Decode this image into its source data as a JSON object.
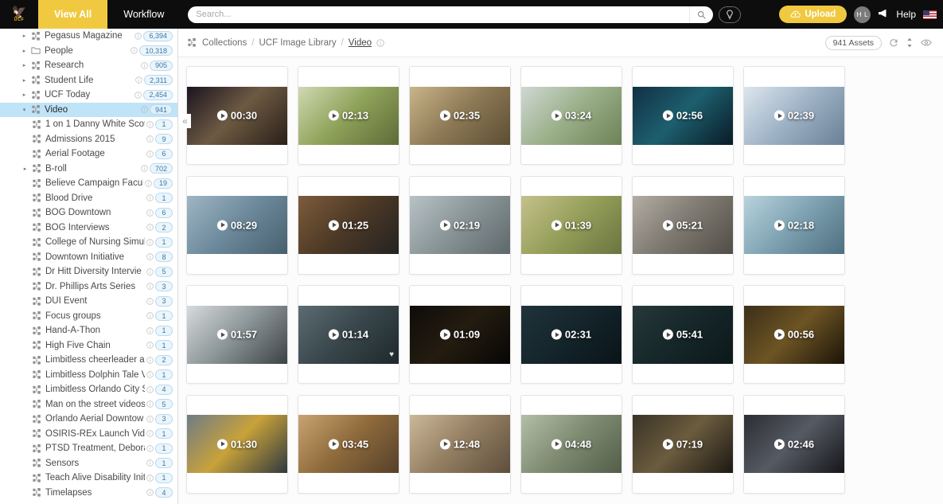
{
  "app": {
    "logo_mark": "🦅",
    "logo_text": "UCF"
  },
  "topbar": {
    "tabs": [
      {
        "label": "View All",
        "active": true
      },
      {
        "label": "Workflow",
        "active": false
      }
    ],
    "search": {
      "placeholder": "Search...",
      "value": "",
      "icon": "search-icon"
    },
    "pin_icon": "pin-icon",
    "upload": {
      "label": "Upload",
      "icon": "cloud-upload-icon"
    },
    "avatar": "H L",
    "megaphone_icon": "megaphone-icon",
    "help_label": "Help",
    "flag_icon": "us-flag-icon"
  },
  "sidebar": {
    "collapse_icon": "«",
    "items": [
      {
        "label": "Pegasus Magazine",
        "count": "6,394",
        "level": 1,
        "caret": "▸",
        "icon": "collection-icon",
        "selected": false
      },
      {
        "label": "People",
        "count": "10,318",
        "level": 1,
        "caret": "▸",
        "icon": "folder-icon",
        "selected": false
      },
      {
        "label": "Research",
        "count": "905",
        "level": 1,
        "caret": "▸",
        "icon": "collection-icon",
        "selected": false
      },
      {
        "label": "Student Life",
        "count": "2,311",
        "level": 1,
        "caret": "▸",
        "icon": "collection-icon",
        "selected": false
      },
      {
        "label": "UCF Today",
        "count": "2,454",
        "level": 1,
        "caret": "▸",
        "icon": "collection-icon",
        "selected": false
      },
      {
        "label": "Video",
        "count": "941",
        "level": 1,
        "caret": "▾",
        "icon": "collection-icon",
        "selected": true
      },
      {
        "label": "1 on 1 Danny White Scot",
        "count": "1",
        "level": 2,
        "caret": "",
        "icon": "collection-icon",
        "selected": false
      },
      {
        "label": "Admissions 2015",
        "count": "9",
        "level": 2,
        "caret": "",
        "icon": "collection-icon",
        "selected": false
      },
      {
        "label": "Aerial Footage",
        "count": "6",
        "level": 2,
        "caret": "",
        "icon": "collection-icon",
        "selected": false
      },
      {
        "label": "B-roll",
        "count": "702",
        "level": 2,
        "caret": "▸",
        "icon": "collection-icon",
        "selected": false
      },
      {
        "label": "Believe Campaign Facul",
        "count": "19",
        "level": 2,
        "caret": "",
        "icon": "collection-icon",
        "selected": false
      },
      {
        "label": "Blood Drive",
        "count": "1",
        "level": 2,
        "caret": "",
        "icon": "collection-icon",
        "selected": false
      },
      {
        "label": "BOG Downtown",
        "count": "6",
        "level": 2,
        "caret": "",
        "icon": "collection-icon",
        "selected": false
      },
      {
        "label": "BOG Interviews",
        "count": "2",
        "level": 2,
        "caret": "",
        "icon": "collection-icon",
        "selected": false
      },
      {
        "label": "College of Nursing Simul",
        "count": "1",
        "level": 2,
        "caret": "",
        "icon": "collection-icon",
        "selected": false
      },
      {
        "label": "Downtown Initiative",
        "count": "8",
        "level": 2,
        "caret": "",
        "icon": "collection-icon",
        "selected": false
      },
      {
        "label": "Dr Hitt Diversity Intervie",
        "count": "5",
        "level": 2,
        "caret": "",
        "icon": "collection-icon",
        "selected": false
      },
      {
        "label": "Dr. Phillips Arts Series",
        "count": "3",
        "level": 2,
        "caret": "",
        "icon": "collection-icon",
        "selected": false
      },
      {
        "label": "DUI Event",
        "count": "3",
        "level": 2,
        "caret": "",
        "icon": "collection-icon",
        "selected": false
      },
      {
        "label": "Focus groups",
        "count": "1",
        "level": 2,
        "caret": "",
        "icon": "collection-icon",
        "selected": false
      },
      {
        "label": "Hand-A-Thon",
        "count": "1",
        "level": 2,
        "caret": "",
        "icon": "collection-icon",
        "selected": false
      },
      {
        "label": "High Five Chain",
        "count": "1",
        "level": 2,
        "caret": "",
        "icon": "collection-icon",
        "selected": false
      },
      {
        "label": "Limbitless cheerleader ar",
        "count": "2",
        "level": 2,
        "caret": "",
        "icon": "collection-icon",
        "selected": false
      },
      {
        "label": "Limbitless Dolphin Tale V",
        "count": "1",
        "level": 2,
        "caret": "",
        "icon": "collection-icon",
        "selected": false
      },
      {
        "label": "Limbitless Orlando City S",
        "count": "4",
        "level": 2,
        "caret": "",
        "icon": "collection-icon",
        "selected": false
      },
      {
        "label": "Man on the street videos",
        "count": "5",
        "level": 2,
        "caret": "",
        "icon": "collection-icon",
        "selected": false
      },
      {
        "label": "Orlando Aerial Downtow",
        "count": "3",
        "level": 2,
        "caret": "",
        "icon": "collection-icon",
        "selected": false
      },
      {
        "label": "OSIRIS-REx Launch Vide",
        "count": "1",
        "level": 2,
        "caret": "",
        "icon": "collection-icon",
        "selected": false
      },
      {
        "label": "PTSD Treatment, Debora",
        "count": "1",
        "level": 2,
        "caret": "",
        "icon": "collection-icon",
        "selected": false
      },
      {
        "label": "Sensors",
        "count": "1",
        "level": 2,
        "caret": "",
        "icon": "collection-icon",
        "selected": false
      },
      {
        "label": "Teach Alive Disability Init",
        "count": "1",
        "level": 2,
        "caret": "",
        "icon": "collection-icon",
        "selected": false
      },
      {
        "label": "Timelapses",
        "count": "4",
        "level": 2,
        "caret": "",
        "icon": "collection-icon",
        "selected": false
      }
    ]
  },
  "main": {
    "breadcrumb": [
      {
        "label": "Collections",
        "current": false
      },
      {
        "label": "UCF Image Library",
        "current": false
      },
      {
        "label": "Video",
        "current": true
      }
    ],
    "separator": "/",
    "asset_count_label": "941 Assets",
    "tools": [
      {
        "name": "refresh-icon",
        "glyph": "⟳"
      },
      {
        "name": "sort-icon",
        "glyph": "⇅"
      },
      {
        "name": "visibility-icon",
        "glyph": "◎"
      }
    ],
    "assets": [
      {
        "duration": "00:30",
        "favorite": false,
        "c1": "#1b1420",
        "c2": "#6d5a43",
        "c3": "#2a1f18"
      },
      {
        "duration": "02:13",
        "favorite": false,
        "c1": "#cfd9b2",
        "c2": "#8fa35a",
        "c3": "#5e6b37"
      },
      {
        "duration": "02:35",
        "favorite": false,
        "c1": "#c9b48a",
        "c2": "#8e7a56",
        "c3": "#5c4d33"
      },
      {
        "duration": "03:24",
        "favorite": false,
        "c1": "#cfd8d4",
        "c2": "#9bb08a",
        "c3": "#6d8257"
      },
      {
        "duration": "02:56",
        "favorite": false,
        "c1": "#123044",
        "c2": "#1d5f6e",
        "c3": "#0a1a26"
      },
      {
        "duration": "02:39",
        "favorite": false,
        "c1": "#dde6ee",
        "c2": "#9fb3c6",
        "c3": "#6a8096"
      },
      {
        "duration": "08:29",
        "favorite": false,
        "c1": "#9fb6c4",
        "c2": "#6d8a9c",
        "c3": "#47606e"
      },
      {
        "duration": "01:25",
        "favorite": false,
        "c1": "#7d5c3c",
        "c2": "#4e3a26",
        "c3": "#30221616"
      },
      {
        "duration": "02:19",
        "favorite": false,
        "c1": "#b9c3c7",
        "c2": "#8a9598",
        "c3": "#5e686b"
      },
      {
        "duration": "01:39",
        "favorite": false,
        "c1": "#c5c08d",
        "c2": "#96a05a",
        "c3": "#6a7440"
      },
      {
        "duration": "05:21",
        "favorite": false,
        "c1": "#b3ada4",
        "c2": "#7f7a71",
        "c3": "#514d47"
      },
      {
        "duration": "02:18",
        "favorite": false,
        "c1": "#b9d3dd",
        "c2": "#7fa3b3",
        "c3": "#4e6f80"
      },
      {
        "duration": "01:57",
        "favorite": false,
        "c1": "#d7dbdd",
        "c2": "#8d9698",
        "c3": "#3b4245"
      },
      {
        "duration": "01:14",
        "favorite": true,
        "c1": "#5c6c72",
        "c2": "#39474c",
        "c3": "#1e282b"
      },
      {
        "duration": "01:09",
        "favorite": false,
        "c1": "#0e0c0a",
        "c2": "#241c10",
        "c3": "#070605"
      },
      {
        "duration": "02:31",
        "favorite": false,
        "c1": "#20333a",
        "c2": "#14252b",
        "c3": "#0a1418"
      },
      {
        "duration": "05:41",
        "favorite": false,
        "c1": "#26383a",
        "c2": "#16272a",
        "c3": "#0c181a"
      },
      {
        "duration": "00:56",
        "favorite": false,
        "c1": "#3b2f18",
        "c2": "#6d5424",
        "c3": "#1b1409"
      },
      {
        "duration": "01:30",
        "favorite": false,
        "c1": "#6f7c86",
        "c2": "#c8a23a",
        "c3": "#30383f"
      },
      {
        "duration": "03:45",
        "favorite": false,
        "c1": "#c8a472",
        "c2": "#8f6b3c",
        "c3": "#55402a"
      },
      {
        "duration": "12:48",
        "favorite": false,
        "c1": "#cbb79a",
        "c2": "#957f63",
        "c3": "#5d4e3c"
      },
      {
        "duration": "04:48",
        "favorite": false,
        "c1": "#b3bfa8",
        "c2": "#7f8c72",
        "c3": "#535d49"
      },
      {
        "duration": "07:19",
        "favorite": false,
        "c1": "#3a3326",
        "c2": "#6b5c3f",
        "c3": "#1c1812"
      },
      {
        "duration": "02:46",
        "favorite": false,
        "c1": "#2b2d33",
        "c2": "#565a63",
        "c3": "#15161a"
      }
    ]
  }
}
